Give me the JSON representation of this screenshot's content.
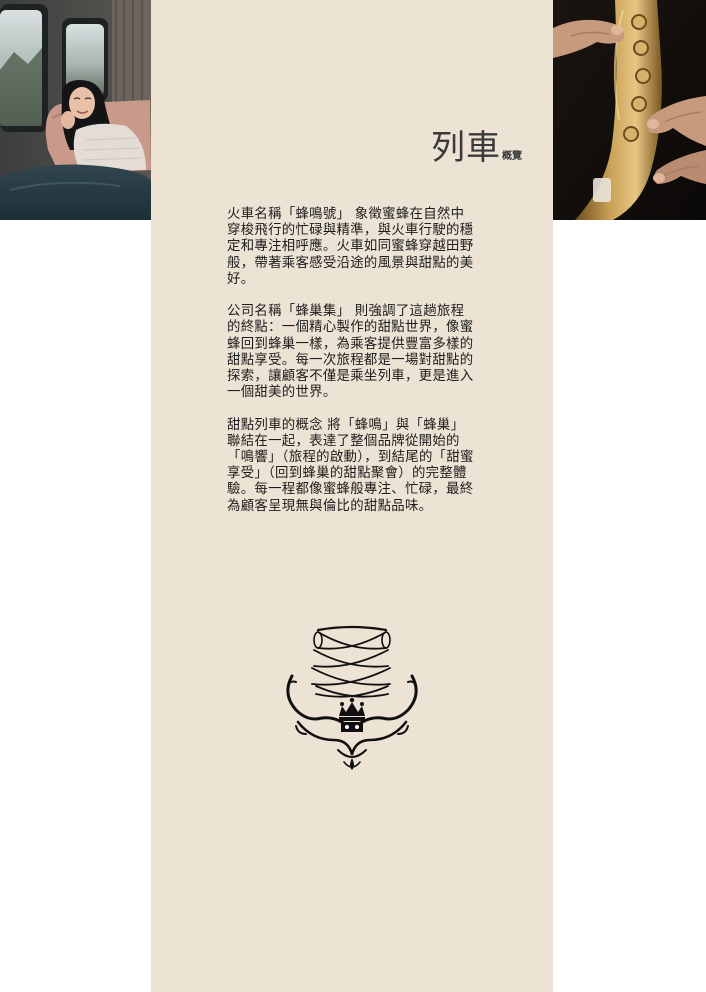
{
  "header": {
    "title": "列車",
    "subtitle": "概覽"
  },
  "paragraphs": [
    "火車名稱「蜂鳴號」 象徵蜜蜂在自然中穿梭飛行的忙碌與精準，與火車行駛的穩定和專注相呼應。火車如同蜜蜂穿越田野般，帶著乘客感受沿途的風景與甜點的美好。",
    "公司名稱「蜂巢集」 則強調了這趟旅程的終點：一個精心製作的甜點世界，像蜜蜂回到蜂巢一樣，為乘客提供豐富多樣的甜點享受。每一次旅程都是一場對甜點的探索，讓顧客不僅是乘坐列車，更是進入一個甜美的世界。",
    "甜點列車的概念 將「蜂鳴」與「蜂巢」聯結在一起，表達了整個品牌從開始的「鳴響」（旅程的啟動），到結尾的「甜蜜享受」（回到蜂巢的甜點聚會）的完整體驗。每一程都像蜜蜂般專注、忙碌，最終為顧客呈現無與倫比的甜點品味。"
  ],
  "images": {
    "left": "woman-on-train-photo",
    "right": "saxophone-player-photo",
    "logo": "ornamental-crown-emblem"
  },
  "colors": {
    "panel": "#ede3d4",
    "text": "#1c1c1c",
    "title": "#3a3a3a",
    "ornament": "#111111"
  }
}
